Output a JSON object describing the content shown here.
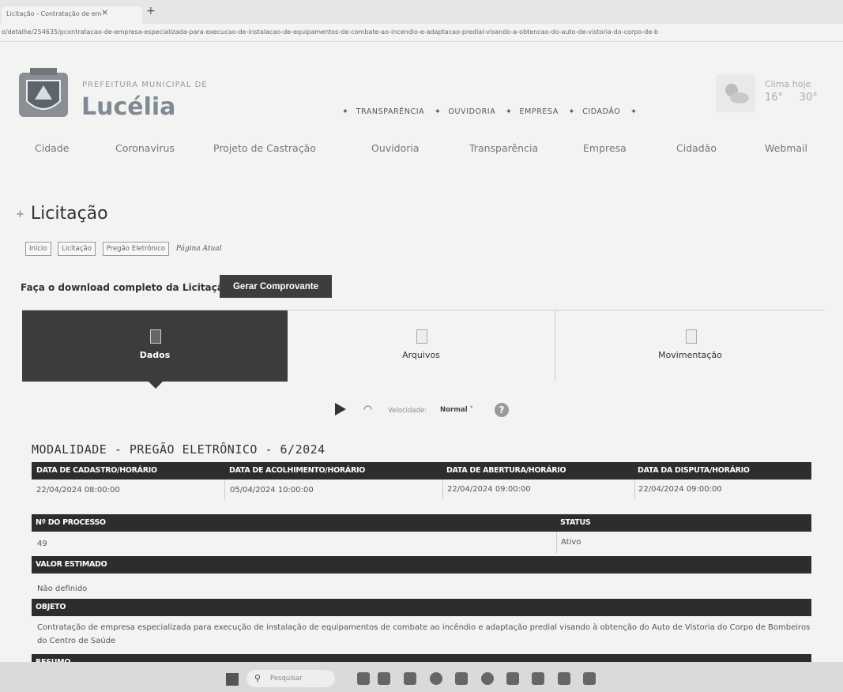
{
  "browser": {
    "tab_title": "Licitação - Contratação de em",
    "tab_close": "×",
    "new_tab": "+",
    "url": "o/detalhe/254635/pcontratacao-de-empresa-especializada-para-execucao-de-instalacao-de-equipamentos-de-combate-ao-incendio-e-adaptacao-predial-visando-a-obtencao-do-auto-de-vistoria-do-corpo-de-b"
  },
  "header": {
    "brand_sub": "PREFEITURA MUNICIPAL DE",
    "brand_name": "Lucélia",
    "topnav": [
      "TRANSPARÊNCIA",
      "OUVIDORIA",
      "EMPRESA",
      "CIDADÃO"
    ],
    "weather_label": "Clima hoje",
    "weather_min": "16°",
    "weather_max": "30°"
  },
  "mainnav": [
    "Cidade",
    "Coronavirus",
    "Projeto de Castração",
    "Ouvidoria",
    "Transparência",
    "Empresa",
    "Cidadão",
    "Webmail"
  ],
  "page": {
    "title_bullet": "+",
    "title": "Licitação",
    "breadcrumbs": [
      "Início",
      "Licitação",
      "Pregão Eletrônico"
    ],
    "breadcrumb_current": "Página Atual",
    "download_label": "Faça o download completo da Licitação:",
    "download_button": "Gerar Comprovante"
  },
  "tabs": [
    "Dados",
    "Arquivos",
    "Movimentação"
  ],
  "player": {
    "speed_label": "Velocidade:",
    "speed_value": "Normal ˅",
    "help": "?"
  },
  "licitacao": {
    "title": "MODALIDADE - PREGÃO ELETRÔNICO - 6/2024",
    "h_cadastro": "DATA DE CADASTRO/HORÁRIO",
    "h_acolhimento": "DATA DE ACOLHIMENTO/HORÁRIO",
    "h_abertura": "DATA DE ABERTURA/HORÁRIO",
    "h_disputa": "DATA DA DISPUTA/HORÁRIO",
    "cadastro": "22/04/2024 08:00:00",
    "acolhimento": "05/04/2024 10:00:00",
    "abertura": "22/04/2024 09:00:00",
    "disputa": "22/04/2024 09:00:00",
    "h_processo": "Nº DO PROCESSO",
    "h_status": "STATUS",
    "processo": "49",
    "status": "Ativo",
    "h_valor": "VALOR ESTIMADO",
    "valor": "Não definido",
    "h_objeto": "OBJETO",
    "objeto": "Contratação de empresa especializada para execução de instalação de equipamentos de combate ao incêndio e adaptação predial visando à obtenção do Auto de Vistoria do Corpo de Bombeiros do Centro de Saúde",
    "h_resumo": "RESUMO"
  },
  "taskbar": {
    "search": "Pesquisar",
    "search_icon": "search-icon"
  }
}
